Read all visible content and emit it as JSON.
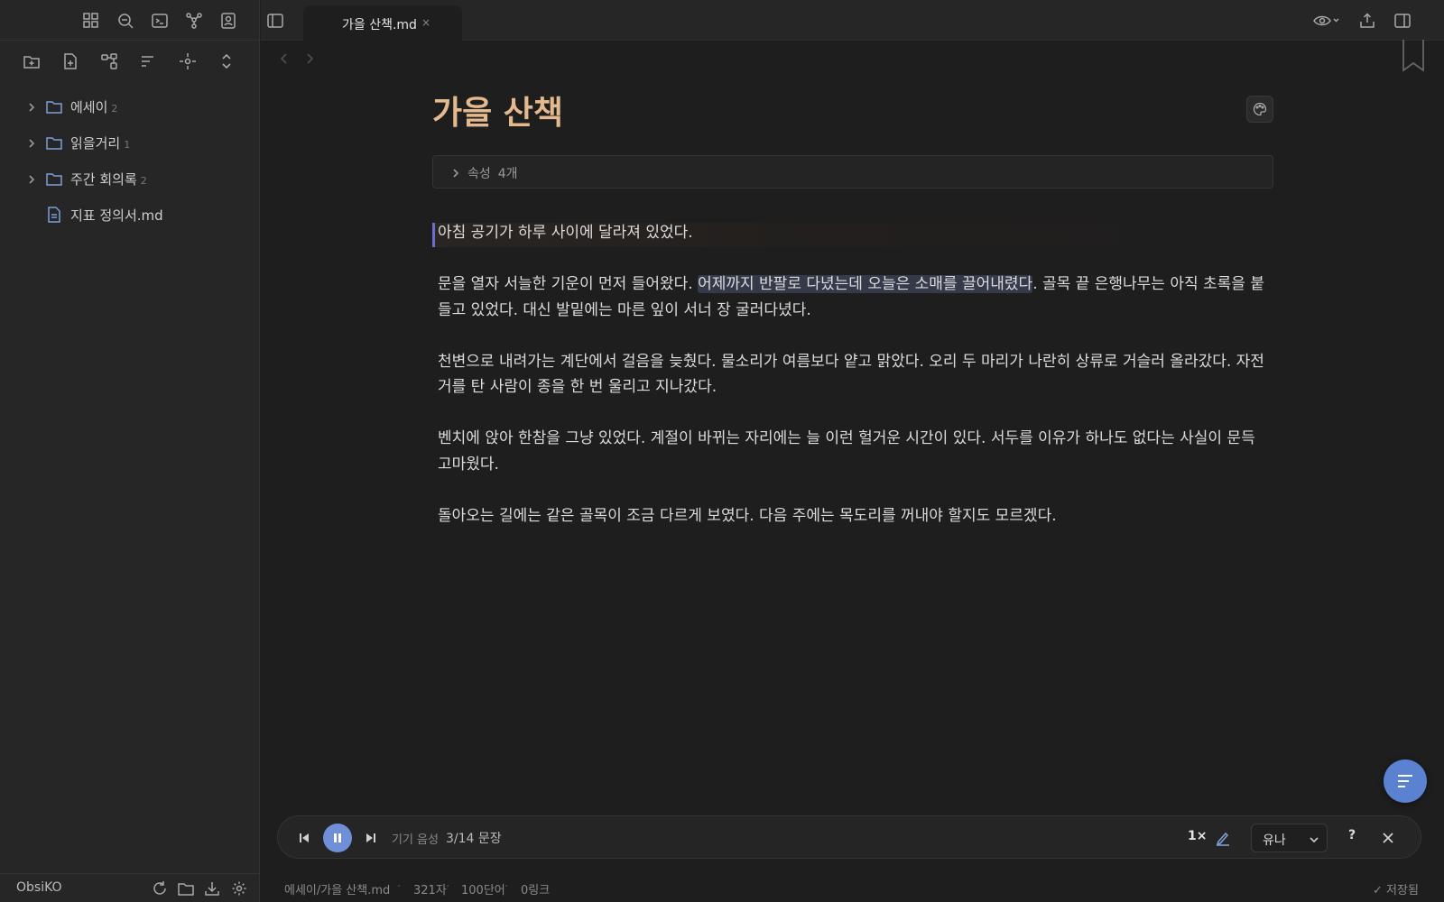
{
  "app": {
    "vault_name": "ObsiKO"
  },
  "tab": {
    "label": "가을 산책.md",
    "close": "×"
  },
  "sidebar": {
    "items": [
      {
        "type": "folder",
        "label": "에세이",
        "count": "2"
      },
      {
        "type": "folder",
        "label": "읽을거리",
        "count": "1"
      },
      {
        "type": "folder",
        "label": "주간 회의록",
        "count": "2"
      },
      {
        "type": "file",
        "label": "지표 정의서.md",
        "count": ""
      }
    ]
  },
  "document": {
    "title": "가을 산책",
    "properties": {
      "label": "속성",
      "count": "4개"
    },
    "p1": "아침 공기가 하루 사이에 달라져 있었다.",
    "p2_pre": "문을 열자 서늘한 기운이 먼저 들어왔다. ",
    "p2_hl": "어제까지 반팔로 다녔는데 오늘은 소매를 끌어내렸다",
    "p2_post": ". 골목 끝 은행나무는 아직 초록을 붙들고 있었다. 대신 발밑에는 마른 잎이 서너 장 굴러다녔다.",
    "p3": "천변으로 내려가는 계단에서 걸음을 늦췄다. 물소리가 여름보다 얕고 맑았다. 오리 두 마리가 나란히 상류로 거슬러 올라갔다. 자전거를 탄 사람이 종을 한 번 울리고 지나갔다.",
    "p4": "벤치에 앉아 한참을 그냥 있었다. 계절이 바뀌는 자리에는 늘 이런 헐거운 시간이 있다. 서두를 이유가 하나도 없다는 사실이 문득 고마웠다.",
    "p5": "돌아오는 길에는 같은 골목이 조금 다르게 보였다. 다음 주에는 목도리를 꺼내야 할지도 모르겠다."
  },
  "player": {
    "source": "기기 음성",
    "progress": "3/14 문장",
    "speed": "1×",
    "voice": "유나",
    "help": "?"
  },
  "status": {
    "path": "에세이/가을 산책.md",
    "chars": "321자",
    "words": "100단어",
    "links": "0링크",
    "saved": "✓ 저장됨",
    "sep": "·"
  },
  "colors": {
    "accent": "#5b82d0",
    "title": "#e3b98d",
    "folder": "#7b9fd8"
  }
}
